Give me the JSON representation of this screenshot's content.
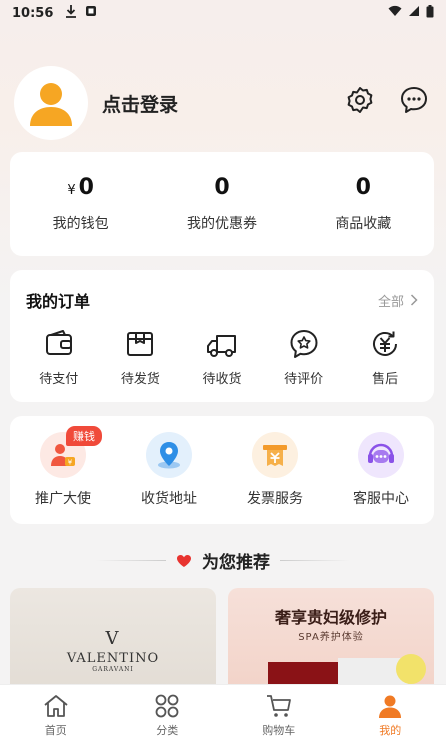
{
  "status_bar": {
    "time": "10:56"
  },
  "profile": {
    "login_label": "点击登录"
  },
  "stats": [
    {
      "currency": "¥",
      "value": "0",
      "label": "我的钱包"
    },
    {
      "currency": "",
      "value": "0",
      "label": "我的优惠券"
    },
    {
      "currency": "",
      "value": "0",
      "label": "商品收藏"
    }
  ],
  "orders": {
    "title": "我的订单",
    "all_label": "全部",
    "items": [
      {
        "label": "待支付",
        "icon": "wallet-icon"
      },
      {
        "label": "待发货",
        "icon": "package-icon"
      },
      {
        "label": "待收货",
        "icon": "truck-icon"
      },
      {
        "label": "待评价",
        "icon": "star-comment-icon"
      },
      {
        "label": "售后",
        "icon": "refund-icon"
      }
    ]
  },
  "services": {
    "badge": "赚钱",
    "items": [
      {
        "label": "推广大使",
        "icon": "ambassador-icon",
        "color": "#f0573f"
      },
      {
        "label": "收货地址",
        "icon": "location-icon",
        "color": "#2f8fe6"
      },
      {
        "label": "发票服务",
        "icon": "invoice-icon",
        "color": "#f39a2a"
      },
      {
        "label": "客服中心",
        "icon": "headset-icon",
        "color": "#8a52e8"
      }
    ]
  },
  "recommend": {
    "title": "为您推荐"
  },
  "products": {
    "left": {
      "brand_mark": "V",
      "brand": "VALENTINO",
      "sub": "GARAVANI"
    },
    "right": {
      "title": "奢享贵妇级修护",
      "subtitle": "SPA养护体验"
    }
  },
  "tabbar": {
    "items": [
      {
        "label": "首页",
        "icon": "home-icon"
      },
      {
        "label": "分类",
        "icon": "category-icon"
      },
      {
        "label": "购物车",
        "icon": "cart-icon"
      },
      {
        "label": "我的",
        "icon": "profile-icon"
      }
    ],
    "active_color": "#f07a24"
  }
}
